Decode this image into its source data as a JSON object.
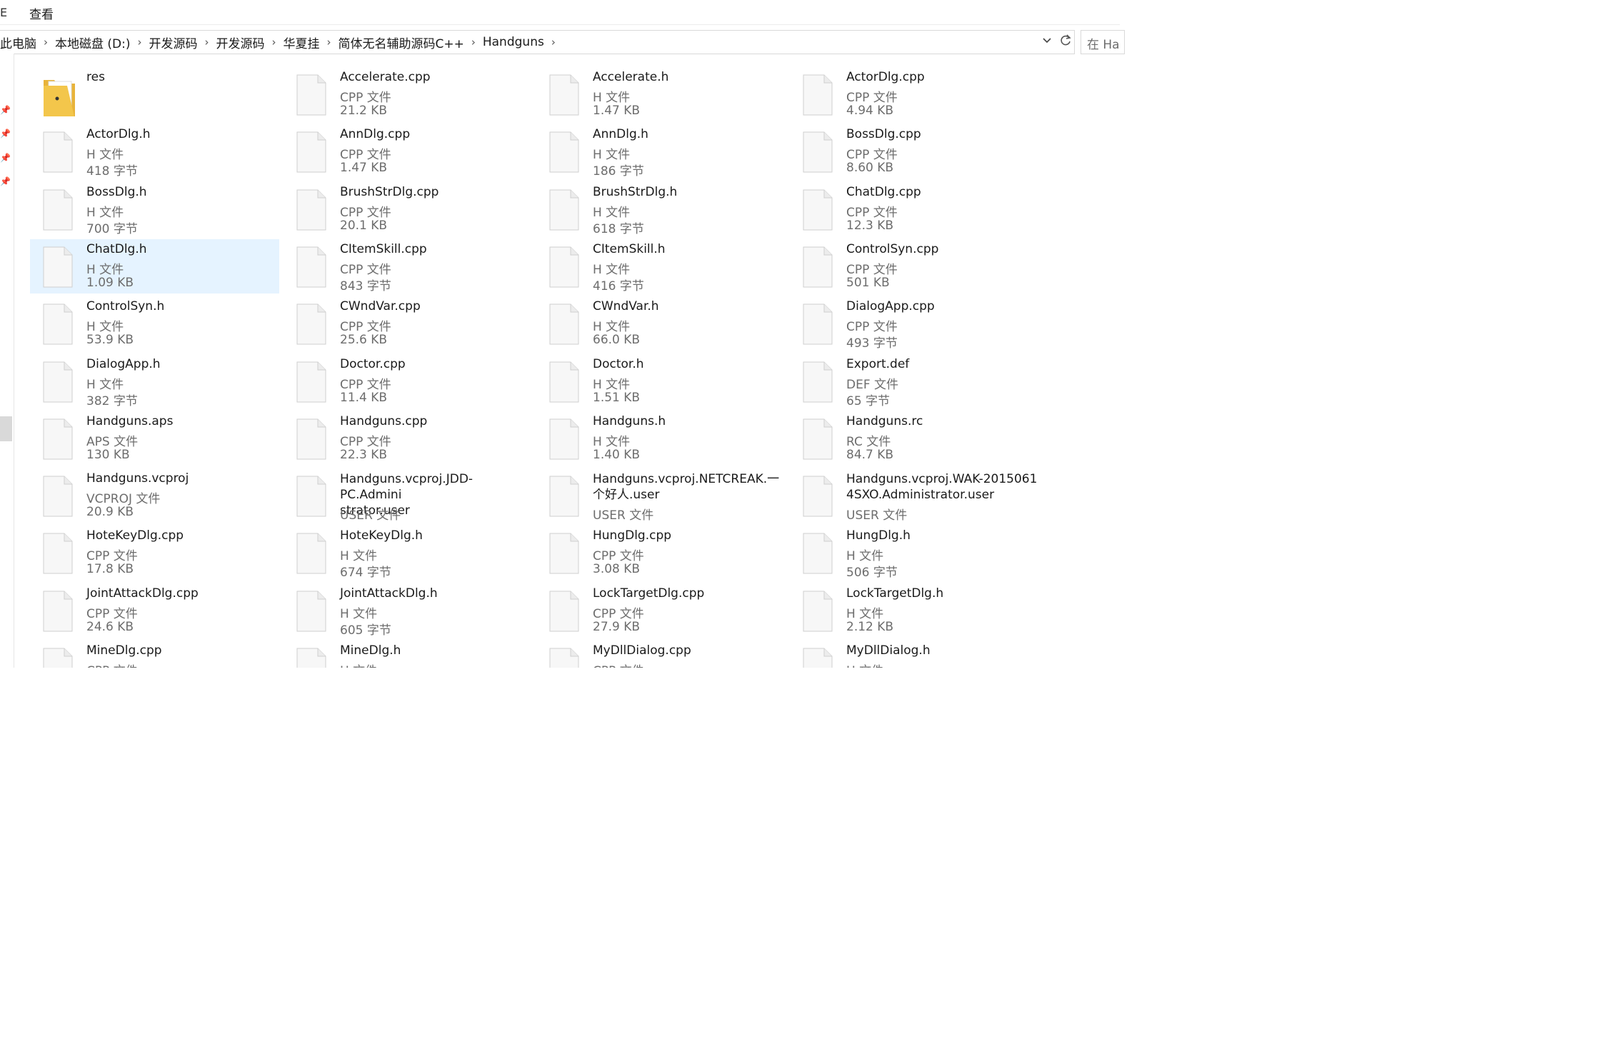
{
  "ribbon": {
    "cut_label": "E",
    "view_tab": "查看"
  },
  "breadcrumb": [
    "此电脑",
    "本地磁盘 (D:)",
    "开发源码",
    "开发源码",
    "华夏挂",
    "简体无名辅助源码C++",
    "Handguns"
  ],
  "address": {
    "dropdown_icon": "chevron-down-icon",
    "refresh_icon": "refresh-icon"
  },
  "search": {
    "placeholder": "在 Ha"
  },
  "files": [
    {
      "name": "res",
      "type": "",
      "size": "",
      "icon": "folder",
      "selected": false
    },
    {
      "name": "Accelerate.cpp",
      "type": "CPP 文件",
      "size": "21.2 KB",
      "icon": "file"
    },
    {
      "name": "Accelerate.h",
      "type": "H 文件",
      "size": "1.47 KB",
      "icon": "file"
    },
    {
      "name": "ActorDlg.cpp",
      "type": "CPP 文件",
      "size": "4.94 KB",
      "icon": "file"
    },
    {
      "name": "ActorDlg.h",
      "type": "H 文件",
      "size": "418 字节",
      "icon": "file"
    },
    {
      "name": "AnnDlg.cpp",
      "type": "CPP 文件",
      "size": "1.47 KB",
      "icon": "file"
    },
    {
      "name": "AnnDlg.h",
      "type": "H 文件",
      "size": "186 字节",
      "icon": "file"
    },
    {
      "name": "BossDlg.cpp",
      "type": "CPP 文件",
      "size": "8.60 KB",
      "icon": "file"
    },
    {
      "name": "BossDlg.h",
      "type": "H 文件",
      "size": "700 字节",
      "icon": "file"
    },
    {
      "name": "BrushStrDlg.cpp",
      "type": "CPP 文件",
      "size": "20.1 KB",
      "icon": "file"
    },
    {
      "name": "BrushStrDlg.h",
      "type": "H 文件",
      "size": "618 字节",
      "icon": "file"
    },
    {
      "name": "ChatDlg.cpp",
      "type": "CPP 文件",
      "size": "12.3 KB",
      "icon": "file"
    },
    {
      "name": "ChatDlg.h",
      "type": "H 文件",
      "size": "1.09 KB",
      "icon": "file",
      "selected": true
    },
    {
      "name": "CItemSkill.cpp",
      "type": "CPP 文件",
      "size": "843 字节",
      "icon": "file"
    },
    {
      "name": "CItemSkill.h",
      "type": "H 文件",
      "size": "416 字节",
      "icon": "file"
    },
    {
      "name": "ControlSyn.cpp",
      "type": "CPP 文件",
      "size": "501 KB",
      "icon": "file"
    },
    {
      "name": "ControlSyn.h",
      "type": "H 文件",
      "size": "53.9 KB",
      "icon": "file"
    },
    {
      "name": "CWndVar.cpp",
      "type": "CPP 文件",
      "size": "25.6 KB",
      "icon": "file"
    },
    {
      "name": "CWndVar.h",
      "type": "H 文件",
      "size": "66.0 KB",
      "icon": "file"
    },
    {
      "name": "DialogApp.cpp",
      "type": "CPP 文件",
      "size": "493 字节",
      "icon": "file"
    },
    {
      "name": "DialogApp.h",
      "type": "H 文件",
      "size": "382 字节",
      "icon": "file"
    },
    {
      "name": "Doctor.cpp",
      "type": "CPP 文件",
      "size": "11.4 KB",
      "icon": "file"
    },
    {
      "name": "Doctor.h",
      "type": "H 文件",
      "size": "1.51 KB",
      "icon": "file"
    },
    {
      "name": "Export.def",
      "type": "DEF 文件",
      "size": "65 字节",
      "icon": "file"
    },
    {
      "name": "Handguns.aps",
      "type": "APS 文件",
      "size": "130 KB",
      "icon": "file"
    },
    {
      "name": "Handguns.cpp",
      "type": "CPP 文件",
      "size": "22.3 KB",
      "icon": "file"
    },
    {
      "name": "Handguns.h",
      "type": "H 文件",
      "size": "1.40 KB",
      "icon": "file"
    },
    {
      "name": "Handguns.rc",
      "type": "RC 文件",
      "size": "84.7 KB",
      "icon": "file"
    },
    {
      "name": "Handguns.vcproj",
      "type": "VCPROJ 文件",
      "size": "20.9 KB",
      "icon": "file"
    },
    {
      "name": "Handguns.vcproj.JDD-PC.Administrator.user",
      "name_lines": [
        "Handguns.vcproj.JDD-PC.Admini",
        "strator.user"
      ],
      "type": "USER 文件",
      "size": "",
      "icon": "file"
    },
    {
      "name": "Handguns.vcproj.NETCREAK.一个好人.user",
      "name_lines": [
        "Handguns.vcproj.NETCREAK.一",
        "个好人.user"
      ],
      "type": "USER 文件",
      "size": "",
      "icon": "file"
    },
    {
      "name": "Handguns.vcproj.WAK-20150614SXO.Administrator.user",
      "name_lines": [
        "Handguns.vcproj.WAK-2015061",
        "4SXO.Administrator.user"
      ],
      "type": "USER 文件",
      "size": "",
      "icon": "file"
    },
    {
      "name": "HoteKeyDlg.cpp",
      "type": "CPP 文件",
      "size": "17.8 KB",
      "icon": "file"
    },
    {
      "name": "HoteKeyDlg.h",
      "type": "H 文件",
      "size": "674 字节",
      "icon": "file"
    },
    {
      "name": "HungDlg.cpp",
      "type": "CPP 文件",
      "size": "3.08 KB",
      "icon": "file"
    },
    {
      "name": "HungDlg.h",
      "type": "H 文件",
      "size": "506 字节",
      "icon": "file"
    },
    {
      "name": "JointAttackDlg.cpp",
      "type": "CPP 文件",
      "size": "24.6 KB",
      "icon": "file"
    },
    {
      "name": "JointAttackDlg.h",
      "type": "H 文件",
      "size": "605 字节",
      "icon": "file"
    },
    {
      "name": "LockTargetDlg.cpp",
      "type": "CPP 文件",
      "size": "27.9 KB",
      "icon": "file"
    },
    {
      "name": "LockTargetDlg.h",
      "type": "H 文件",
      "size": "2.12 KB",
      "icon": "file"
    },
    {
      "name": "MineDlg.cpp",
      "type": "CPP 文件",
      "size": "",
      "icon": "file"
    },
    {
      "name": "MineDlg.h",
      "type": "H 文件",
      "size": "",
      "icon": "file"
    },
    {
      "name": "MyDllDialog.cpp",
      "type": "CPP 文件",
      "size": "",
      "icon": "file"
    },
    {
      "name": "MyDllDialog.h",
      "type": "H 文件",
      "size": "",
      "icon": "file"
    }
  ],
  "colors": {
    "selection": "#e5f3ff",
    "secondary_text": "#6d6d6d",
    "folder": "#f3c64b"
  }
}
